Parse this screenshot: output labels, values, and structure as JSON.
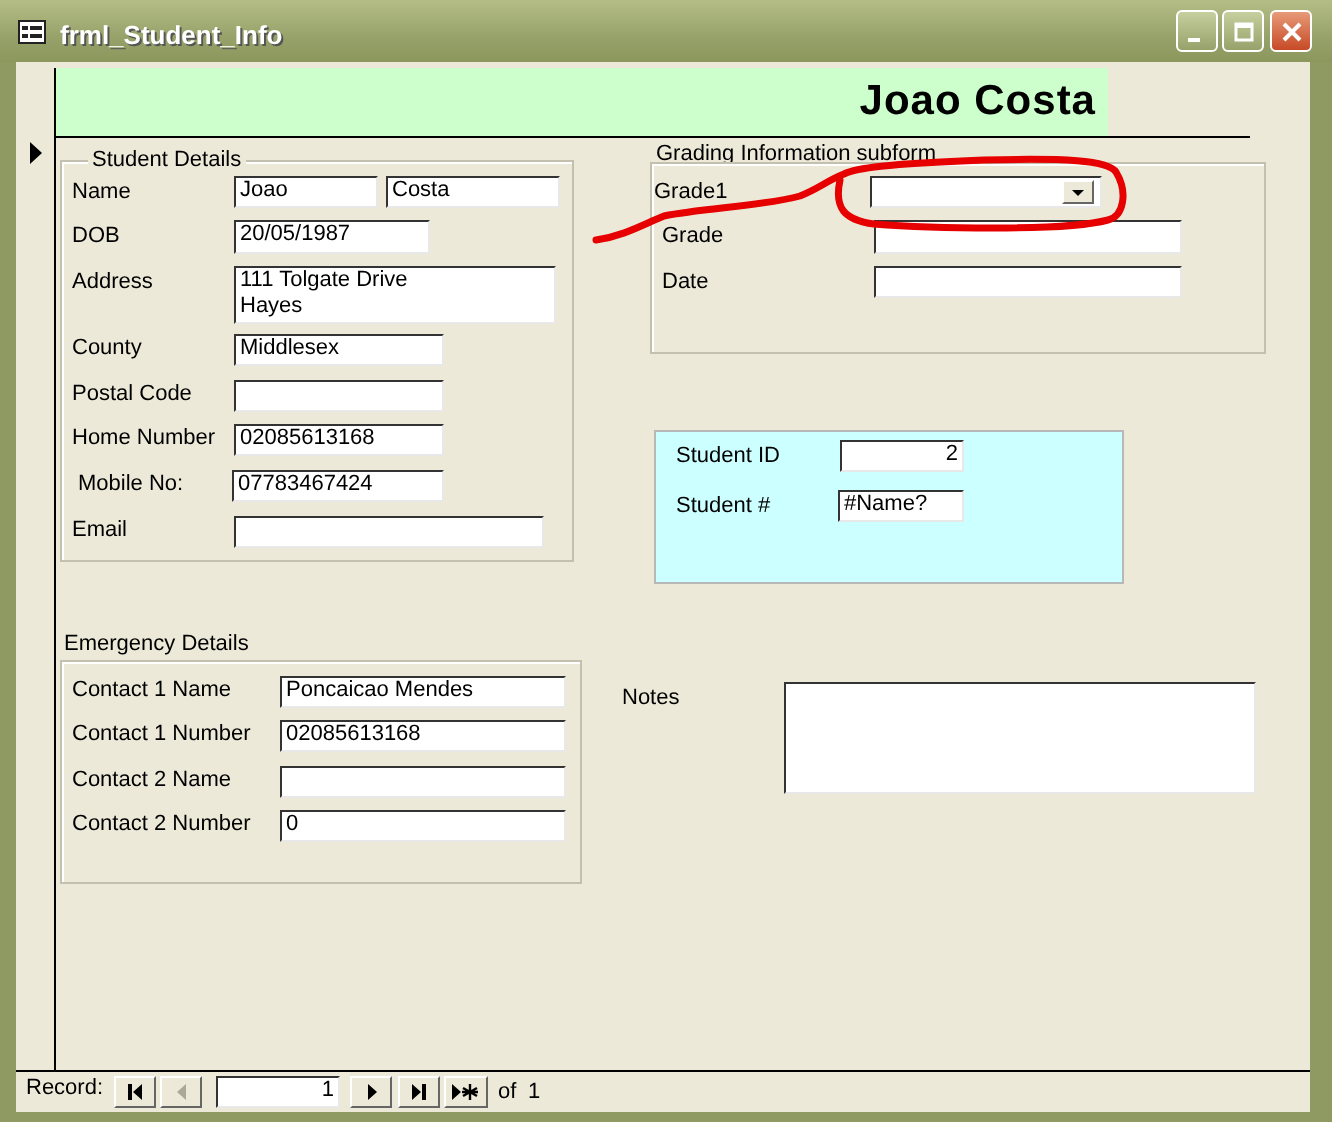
{
  "window": {
    "title": "frml_Student_Info"
  },
  "header": {
    "title": "Joao Costa"
  },
  "student_details": {
    "title": "Student Details",
    "fields": [
      {
        "label": "Name",
        "values": [
          "Joao",
          "Costa"
        ]
      },
      {
        "label": "DOB",
        "values": [
          "20/05/1987"
        ]
      },
      {
        "label": "Address",
        "values": [
          "111 Tolgate Drive\nHayes"
        ]
      },
      {
        "label": "County",
        "values": [
          "Middlesex"
        ]
      },
      {
        "label": "Postal Code"
      },
      {
        "label": "Home Number",
        "values": [
          "02085613168"
        ]
      },
      {
        "label": "Mobile No:",
        "values": [
          "07783467424"
        ]
      },
      {
        "label": "Email"
      }
    ]
  },
  "grading": {
    "title": "Grading  Information subform",
    "fields": [
      {
        "label": "Grade1",
        "kind": "combo"
      },
      {
        "label": "Grade",
        "kind": "text"
      },
      {
        "label": "Date",
        "kind": "text"
      }
    ]
  },
  "id_panel": {
    "fields": [
      {
        "label": "Student ID",
        "value": "2",
        "kind": "number"
      },
      {
        "label": "Student #",
        "value": "#Name?",
        "kind": "text"
      }
    ]
  },
  "emergency": {
    "title": "Emergency Details",
    "fields": [
      {
        "label": "Contact 1 Name",
        "value": "Poncaicao Mendes"
      },
      {
        "label": "Contact 1 Number",
        "value": "02085613168"
      },
      {
        "label": "Contact 2 Name"
      },
      {
        "label": "Contact 2 Number",
        "value": "0"
      }
    ]
  },
  "notes": {
    "label": "Notes"
  },
  "record_nav": {
    "label": "Record:",
    "current": "1",
    "of": "of",
    "total": "1",
    "buttons": [
      {
        "kind": "first",
        "disabled": false
      },
      {
        "kind": "previous",
        "disabled": true
      },
      {
        "kind": "next",
        "disabled": false
      },
      {
        "kind": "last",
        "disabled": false
      },
      {
        "kind": "new",
        "disabled": false
      }
    ]
  }
}
